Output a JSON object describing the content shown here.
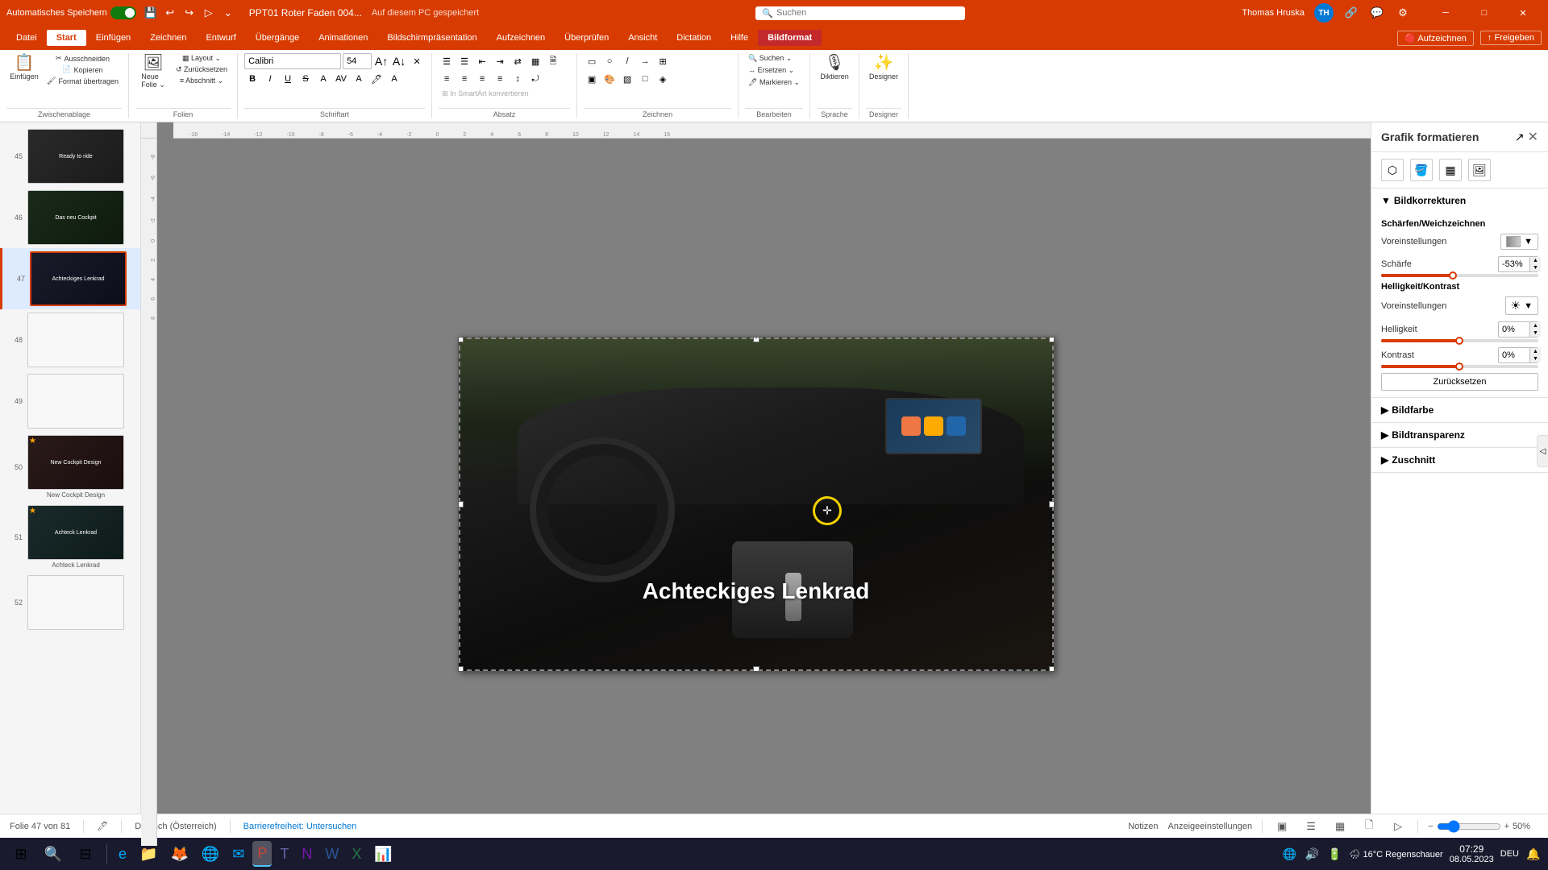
{
  "app": {
    "title": "PPT01 Roter Faden 004...",
    "autosave_label": "Automatisches Speichern",
    "autosave_on": true,
    "save_location": "Auf diesem PC gespeichert",
    "user": "Thomas Hruska",
    "user_initials": "TH"
  },
  "ribbon_tabs": [
    {
      "id": "datei",
      "label": "Datei",
      "active": false
    },
    {
      "id": "start",
      "label": "Start",
      "active": true
    },
    {
      "id": "einfuegen",
      "label": "Einfügen",
      "active": false
    },
    {
      "id": "zeichnen",
      "label": "Zeichnen",
      "active": false
    },
    {
      "id": "entwurf",
      "label": "Entwurf",
      "active": false
    },
    {
      "id": "uebergaenge",
      "label": "Übergänge",
      "active": false
    },
    {
      "id": "animationen",
      "label": "Animationen",
      "active": false
    },
    {
      "id": "bildschirmpraesentation",
      "label": "Bildschirmpräsentation",
      "active": false
    },
    {
      "id": "aufzeichnen",
      "label": "Aufzeichnen",
      "active": false
    },
    {
      "id": "ueberpruefen",
      "label": "Überprüfen",
      "active": false
    },
    {
      "id": "ansicht",
      "label": "Ansicht",
      "active": false
    },
    {
      "id": "dictation",
      "label": "Dictation",
      "active": false
    },
    {
      "id": "hilfe",
      "label": "Hilfe",
      "active": false
    },
    {
      "id": "bildformat",
      "label": "Bildformat",
      "active": false,
      "highlight": true
    }
  ],
  "ribbon_right": {
    "aufzeichnen": "Aufzeichnen",
    "freigeben": "Freigeben"
  },
  "slides": [
    {
      "num": 45,
      "label": "Ready to ride",
      "thumb_class": "thumb-45",
      "text": "Ready to ride",
      "active": false,
      "starred": false
    },
    {
      "num": 46,
      "label": "Das neu Cockpit",
      "thumb_class": "thumb-46",
      "text": "Das neu Cockpit",
      "active": false,
      "starred": false
    },
    {
      "num": 47,
      "label": "Achteckiges Lenkrad",
      "thumb_class": "thumb-47",
      "text": "Achteckiges Lenkrad",
      "active": true,
      "starred": false
    },
    {
      "num": 48,
      "label": "",
      "thumb_class": "thumb-48",
      "text": "",
      "active": false,
      "starred": false
    },
    {
      "num": 49,
      "label": "",
      "thumb_class": "thumb-49",
      "text": "",
      "active": false,
      "starred": false
    },
    {
      "num": 50,
      "label": "New Cockpit Design",
      "thumb_class": "thumb-50",
      "text": "New Cockpit Design",
      "active": false,
      "starred": true
    },
    {
      "num": 51,
      "label": "Achteck Lenkrad",
      "thumb_class": "thumb-51",
      "text": "Achteck Lenkrad",
      "active": false,
      "starred": true
    },
    {
      "num": 52,
      "label": "",
      "thumb_class": "thumb-52",
      "text": "",
      "active": false,
      "starred": false
    }
  ],
  "slide": {
    "overlay_text": "Achteckiges Lenkrad"
  },
  "right_panel": {
    "title": "Grafik formatieren",
    "sections": {
      "bildkorrekturen": {
        "label": "Bildkorrekturen",
        "expanded": true,
        "subsection": "Schärfen/Weichzeichnen",
        "presets_label": "Voreinstellungen",
        "schaerfe_label": "Schärfe",
        "schaerfe_value": "-53%",
        "schaerfe_pct": 47,
        "helligkeit_kontrast": "Helligkeit/Kontrast",
        "voreinstellungen": "Voreinstellungen",
        "helligkeit_label": "Helligkeit",
        "helligkeit_value": "0%",
        "helligkeit_pct": 50,
        "kontrast_label": "Kontrast",
        "kontrast_value": "0%",
        "kontrast_pct": 50,
        "reset_label": "Zurücksetzen"
      },
      "bildfarbe": {
        "label": "Bildfarbe",
        "expanded": false
      },
      "bildtransparenz": {
        "label": "Bildtransparenz",
        "expanded": false
      },
      "zuschnitt": {
        "label": "Zuschnitt",
        "expanded": false
      }
    }
  },
  "status_bar": {
    "slide_info": "Folie 47 von 81",
    "language": "Deutsch (Österreich)",
    "accessibility": "Barrierefreiheit: Untersuchen",
    "notizen": "Notizen",
    "anzeigeeinstellungen": "Anzeigeeinstellungen",
    "zoom": "50%"
  },
  "taskbar": {
    "time": "07:29",
    "date": "08.05.2023",
    "weather": "16°C Regenschauer",
    "keyboard": "DEU"
  },
  "groups": {
    "zwischenablage": "Zwischenablage",
    "folien": "Folien",
    "schriftart": "Schriftart",
    "absatz": "Absatz",
    "zeichnen": "Zeichnen",
    "bearbeiten": "Bearbeiten",
    "sprache": "Sprache",
    "designer": "Designer"
  },
  "buttons": {
    "ausschneiden": "Ausschneiden",
    "kopieren": "Kopieren",
    "zuruecksetzen": "Zurücksetzen",
    "format_uebertragen": "Format übertragen",
    "neue_folie": "Neue Folie",
    "layout": "Layout",
    "zuruecksetzen_folie": "Zurücksetzen",
    "abschnitt": "Abschnitt",
    "diktieren": "Diktieren",
    "designer_btn": "Designer"
  },
  "search": {
    "placeholder": "Suchen"
  }
}
